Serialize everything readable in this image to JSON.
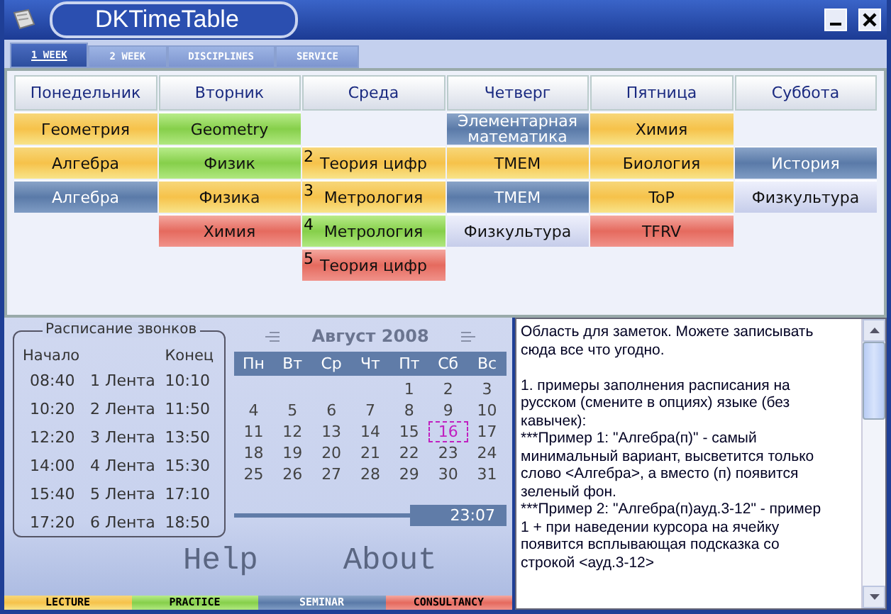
{
  "window": {
    "title": "DKTimeTable"
  },
  "tabs": [
    {
      "label": "1 WEEK",
      "selected": true
    },
    {
      "label": "2 WEEK",
      "selected": false
    },
    {
      "label": "DISCIPLINES",
      "selected": false
    },
    {
      "label": "SERVICE",
      "selected": false
    }
  ],
  "timetable": {
    "days": [
      {
        "name": "Понедельник",
        "lessons": [
          {
            "kind": "lecture",
            "subject": "Геометрия"
          },
          {
            "kind": "lecture",
            "subject": "Алгебра"
          },
          {
            "kind": "seminar",
            "subject": "Алгебра"
          },
          {
            "kind": "empty"
          },
          {
            "kind": "empty"
          }
        ]
      },
      {
        "name": "Вторник",
        "lessons": [
          {
            "kind": "practice",
            "subject": "Geometry"
          },
          {
            "kind": "practice",
            "subject": "Физик"
          },
          {
            "kind": "lecture",
            "subject": "Физика"
          },
          {
            "kind": "consultancy",
            "subject": "Химия"
          },
          {
            "kind": "empty"
          }
        ]
      },
      {
        "name": "Среда",
        "lessons": [
          {
            "kind": "empty"
          },
          {
            "kind": "lecture",
            "number": "2",
            "subject": "Теория цифр"
          },
          {
            "kind": "lecture",
            "number": "3",
            "subject": "Метрология"
          },
          {
            "kind": "practice",
            "number": "4",
            "subject": "Метрология"
          },
          {
            "kind": "consultancy",
            "number": "5",
            "subject": "Теория цифр"
          }
        ]
      },
      {
        "name": "Четверг",
        "lessons": [
          {
            "kind": "seminar",
            "subject": "Элементарная математика"
          },
          {
            "kind": "lecture",
            "subject": "ТМЕМ"
          },
          {
            "kind": "seminar",
            "subject": "ТМЕМ"
          },
          {
            "kind": "other",
            "subject": "Физкультура"
          },
          {
            "kind": "empty"
          }
        ]
      },
      {
        "name": "Пятница",
        "lessons": [
          {
            "kind": "lecture",
            "subject": "Химия"
          },
          {
            "kind": "lecture",
            "subject": "Биология"
          },
          {
            "kind": "lecture",
            "subject": "ToP"
          },
          {
            "kind": "consultancy",
            "subject": "TFRV"
          },
          {
            "kind": "empty"
          }
        ]
      },
      {
        "name": "Суббота",
        "lessons": [
          {
            "kind": "empty"
          },
          {
            "kind": "seminar",
            "subject": "История"
          },
          {
            "kind": "other",
            "subject": "Физкультура"
          },
          {
            "kind": "empty"
          },
          {
            "kind": "empty"
          }
        ]
      }
    ]
  },
  "bell_schedule": {
    "title": "Расписание звонков",
    "start_label": "Начало",
    "end_label": "Конец",
    "periods": [
      {
        "start": "08:40",
        "name": "1 Лента",
        "end": "10:10"
      },
      {
        "start": "10:20",
        "name": "2 Лента",
        "end": "11:50"
      },
      {
        "start": "12:20",
        "name": "3 Лента",
        "end": "13:50"
      },
      {
        "start": "14:00",
        "name": "4 Лента",
        "end": "15:30"
      },
      {
        "start": "15:40",
        "name": "5 Лента",
        "end": "17:10"
      },
      {
        "start": "17:20",
        "name": "6 Лента",
        "end": "18:50"
      }
    ]
  },
  "calendar": {
    "month": "Август 2008",
    "weekdays": [
      "Пн",
      "Вт",
      "Ср",
      "Чт",
      "Пт",
      "Сб",
      "Вс"
    ],
    "weeks": [
      [
        {
          "day": "1",
          "selected": false
        },
        {
          "day": "2",
          "selected": false
        },
        {
          "day": "3",
          "selected": false
        }
      ],
      [
        {
          "day": "4",
          "selected": false
        },
        {
          "day": "5",
          "selected": false
        },
        {
          "day": "6",
          "selected": false
        },
        {
          "day": "7",
          "selected": false
        },
        {
          "day": "8",
          "selected": false
        },
        {
          "day": "9",
          "selected": false
        },
        {
          "day": "10",
          "selected": false
        }
      ],
      [
        {
          "day": "11",
          "selected": false
        },
        {
          "day": "12",
          "selected": false
        },
        {
          "day": "13",
          "selected": false
        },
        {
          "day": "14",
          "selected": false
        },
        {
          "day": "15",
          "selected": false
        },
        {
          "day": "16",
          "selected": true
        },
        {
          "day": "17",
          "selected": false
        }
      ],
      [
        {
          "day": "18",
          "selected": false
        },
        {
          "day": "19",
          "selected": false
        },
        {
          "day": "20",
          "selected": false
        },
        {
          "day": "21",
          "selected": false
        },
        {
          "day": "22",
          "selected": false
        },
        {
          "day": "23",
          "selected": false
        },
        {
          "day": "24",
          "selected": false
        }
      ],
      [
        {
          "day": "25",
          "selected": false
        },
        {
          "day": "26",
          "selected": false
        },
        {
          "day": "27",
          "selected": false
        },
        {
          "day": "28",
          "selected": false
        },
        {
          "day": "29",
          "selected": false
        },
        {
          "day": "30",
          "selected": false
        },
        {
          "day": "31",
          "selected": false
        }
      ]
    ],
    "time": "23:07"
  },
  "links": [
    "Help",
    "About"
  ],
  "notes": {
    "paragraphs": [
      {
        "lines": [
          "Область для заметок. Можете записывать сюда все что угодно."
        ]
      },
      {
        "lines": [
          "1. примеры заполнения расписания на русском (смените в опциях) языке (без кавычек):",
          "***Пример 1: \"Алгебра(п)\"  - самый минимальный вариант, высветится только слово <Алгебра>, а вместо (п) появится зеленый фон.",
          "***Пример 2: \"Алгебра(п)ауд.3-12\" - пример 1 + при наведении курсора на ячейку появится всплывающая подсказка со строкой <ауд.3-12>"
        ]
      }
    ]
  },
  "legend": [
    {
      "kind": "lecture",
      "label": "LECTURE"
    },
    {
      "kind": "practice",
      "label": "PRACTICE"
    },
    {
      "kind": "seminar",
      "label": "SEMINAR"
    },
    {
      "kind": "consultancy",
      "label": "CONSULTANCY"
    }
  ]
}
